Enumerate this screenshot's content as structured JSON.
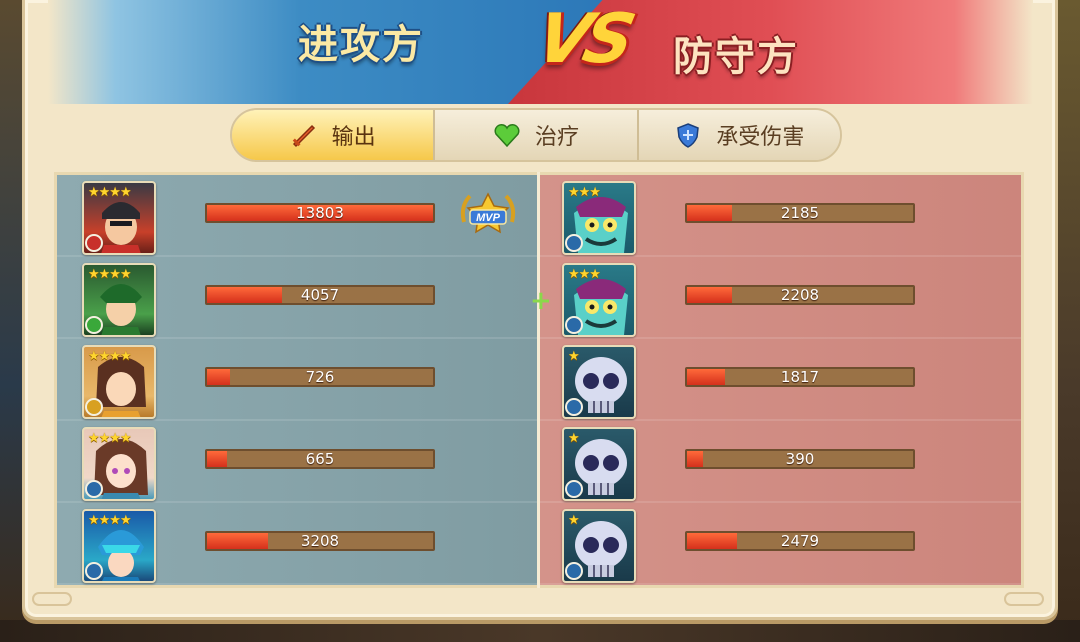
{
  "header": {
    "attacker_title": "进攻方",
    "vs_label": "VS",
    "defender_title": "防守方"
  },
  "tabs": [
    {
      "label": "输出",
      "icon": "sword-icon",
      "active": true
    },
    {
      "label": "治疗",
      "icon": "heart-icon",
      "active": false
    },
    {
      "label": "承受伤害",
      "icon": "shield-icon",
      "active": false
    }
  ],
  "attackers": [
    {
      "stars": "★★★★",
      "value": "13803",
      "fill": 1.0,
      "mvp": true
    },
    {
      "stars": "★★★★",
      "value": "4057",
      "fill": 0.33
    },
    {
      "stars": "★★★★",
      "value": "726",
      "fill": 0.1
    },
    {
      "stars": "★★★★",
      "value": "665",
      "fill": 0.09
    },
    {
      "stars": "★★★★",
      "value": "3208",
      "fill": 0.27
    }
  ],
  "defenders": [
    {
      "stars": "★★★",
      "value": "2185",
      "fill": 0.2
    },
    {
      "stars": "★★★",
      "value": "2208",
      "fill": 0.2
    },
    {
      "stars": "★",
      "value": "1817",
      "fill": 0.17
    },
    {
      "stars": "★",
      "value": "390",
      "fill": 0.07
    },
    {
      "stars": "★",
      "value": "2479",
      "fill": 0.22
    }
  ],
  "mvp_label": "MVP",
  "colors": {
    "attacker_bg": "#7d9ba0",
    "defender_bg": "#d28a80",
    "bar_fill": "#e8401f",
    "bar_track": "#9a7246",
    "star": "#ffd52e"
  }
}
